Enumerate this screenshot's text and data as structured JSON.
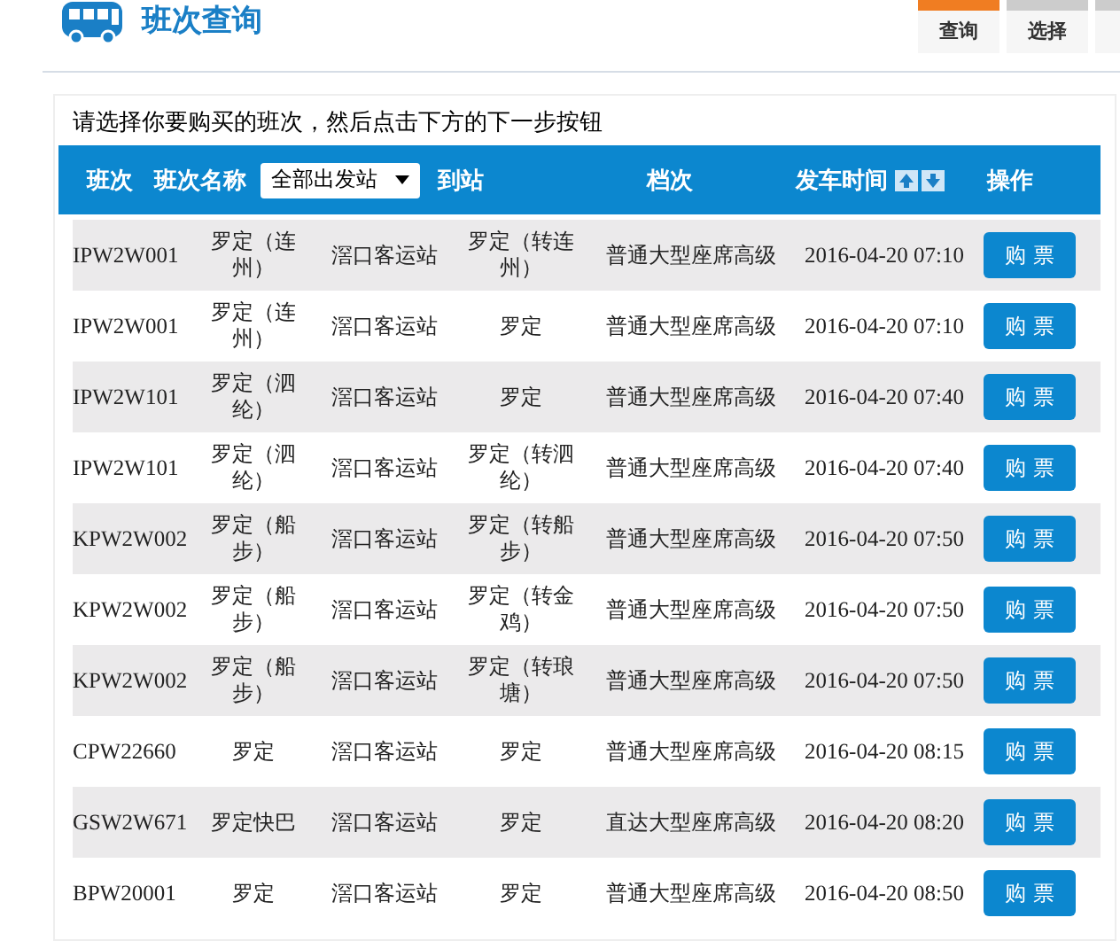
{
  "header": {
    "title": "班次查询"
  },
  "steps": [
    {
      "label": "查询",
      "selected": true
    },
    {
      "label": "选择",
      "selected": false
    }
  ],
  "instruction": "请选择你要购买的班次，然后点击下方的下一步按钮",
  "table": {
    "columns": {
      "id": "班次",
      "name": "班次名称",
      "arrive": "到站",
      "grade": "档次",
      "time": "发车时间",
      "action": "操作"
    },
    "station_select": {
      "value": "全部出发站"
    },
    "rows": [
      {
        "id": "IPW2W001",
        "name": "罗定（连州）",
        "station": "滘口客运站",
        "arrive": "罗定（转连州）",
        "grade": "普通大型座席高级",
        "time": "2016-04-20 07:10",
        "button": "购 票"
      },
      {
        "id": "IPW2W001",
        "name": "罗定（连州）",
        "station": "滘口客运站",
        "arrive": "罗定",
        "grade": "普通大型座席高级",
        "time": "2016-04-20 07:10",
        "button": "购 票"
      },
      {
        "id": "IPW2W101",
        "name": "罗定（泗纶）",
        "station": "滘口客运站",
        "arrive": "罗定",
        "grade": "普通大型座席高级",
        "time": "2016-04-20 07:40",
        "button": "购 票"
      },
      {
        "id": "IPW2W101",
        "name": "罗定（泗纶）",
        "station": "滘口客运站",
        "arrive": "罗定（转泗纶）",
        "grade": "普通大型座席高级",
        "time": "2016-04-20 07:40",
        "button": "购 票"
      },
      {
        "id": "KPW2W002",
        "name": "罗定（船步）",
        "station": "滘口客运站",
        "arrive": "罗定（转船步）",
        "grade": "普通大型座席高级",
        "time": "2016-04-20 07:50",
        "button": "购 票"
      },
      {
        "id": "KPW2W002",
        "name": "罗定（船步）",
        "station": "滘口客运站",
        "arrive": "罗定（转金鸡）",
        "grade": "普通大型座席高级",
        "time": "2016-04-20 07:50",
        "button": "购 票"
      },
      {
        "id": "KPW2W002",
        "name": "罗定（船步）",
        "station": "滘口客运站",
        "arrive": "罗定（转琅塘）",
        "grade": "普通大型座席高级",
        "time": "2016-04-20 07:50",
        "button": "购 票"
      },
      {
        "id": "CPW22660",
        "name": "罗定",
        "station": "滘口客运站",
        "arrive": "罗定",
        "grade": "普通大型座席高级",
        "time": "2016-04-20 08:15",
        "button": "购 票"
      },
      {
        "id": "GSW2W671",
        "name": "罗定快巴",
        "station": "滘口客运站",
        "arrive": "罗定",
        "grade": "直达大型座席高级",
        "time": "2016-04-20 08:20",
        "button": "购 票"
      },
      {
        "id": "BPW20001",
        "name": "罗定",
        "station": "滘口客运站",
        "arrive": "罗定",
        "grade": "普通大型座席高级",
        "time": "2016-04-20 08:50",
        "button": "购 票"
      }
    ]
  }
}
